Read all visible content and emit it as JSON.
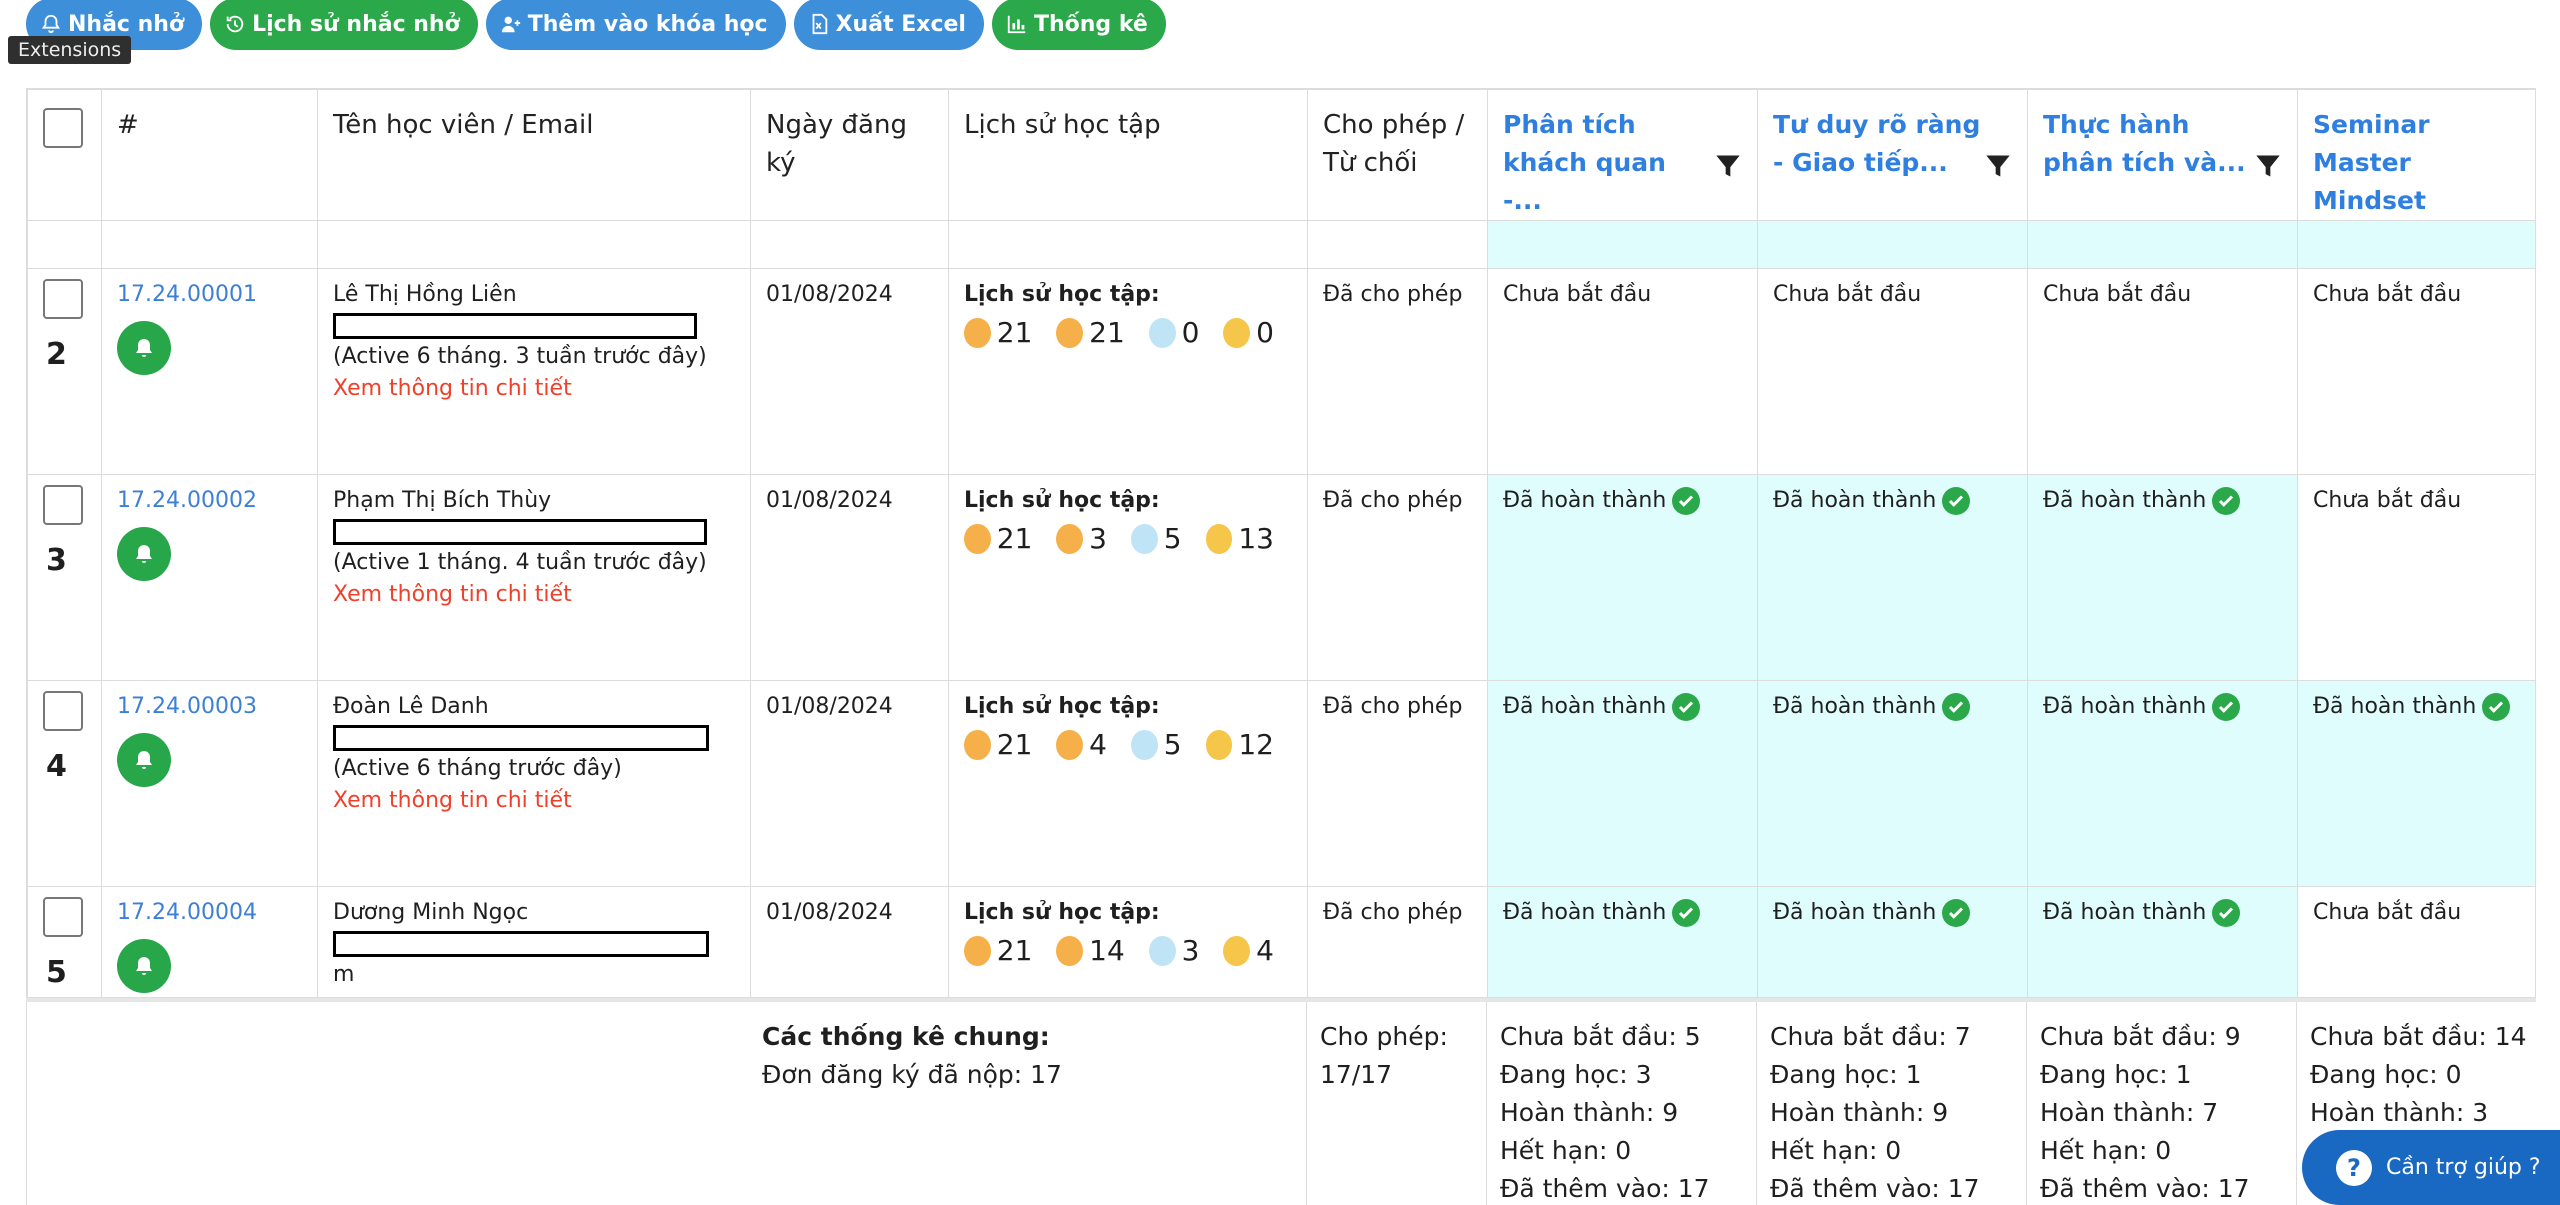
{
  "toolbar": {
    "buttons": [
      {
        "label": "Nhắc nhở",
        "icon": "bell-icon",
        "color": "#3d8fd9"
      },
      {
        "label": "Lịch sử nhắc nhở",
        "icon": "history-icon",
        "color": "#2aa84a"
      },
      {
        "label": "Thêm vào khóa học",
        "icon": "add-user-icon",
        "color": "#3d8fd9"
      },
      {
        "label": "Xuất Excel",
        "icon": "excel-file-icon",
        "color": "#3d8fd9"
      },
      {
        "label": "Thống kê",
        "icon": "bar-chart-icon",
        "color": "#2aa84a"
      }
    ],
    "tooltip": "Extensions"
  },
  "table": {
    "headers": {
      "num": "#",
      "name": "Tên học viên / Email",
      "date": "Ngày đăng ký",
      "history": "Lịch sử học tập",
      "permit": "Cho phép / Từ chối",
      "course1": "Phân tích khách quan -...",
      "course2": "Tư duy rõ ràng - Giao tiếp...",
      "course3": "Thực hành phân tích và...",
      "course4": "Seminar Master Mindset"
    },
    "rows": [
      {
        "num": "2",
        "code": "17.24.00001",
        "name": "Lê Thị Hồng Liên",
        "active": "(Active 6 tháng. 3 tuần trước đây)",
        "detail": "Xem thông tin chi tiết",
        "date": "01/08/2024",
        "history_label": "Lịch sử học tập:",
        "stats": [
          "21",
          "21",
          "0",
          "0"
        ],
        "permit": "Đã cho phép",
        "courses": [
          "Chưa bắt đầu",
          "Chưa bắt đầu",
          "Chưa bắt đầu",
          "Chưa bắt đầu"
        ]
      },
      {
        "num": "3",
        "code": "17.24.00002",
        "name": "Phạm Thị Bích Thùy",
        "active": "(Active 1 tháng. 4 tuần trước đây)",
        "detail": "Xem thông tin chi tiết",
        "date": "01/08/2024",
        "history_label": "Lịch sử học tập:",
        "stats": [
          "21",
          "3",
          "5",
          "13"
        ],
        "permit": "Đã cho phép",
        "courses": [
          "Đã hoàn thành",
          "Đã hoàn thành",
          "Đã hoàn thành",
          "Chưa bắt đầu"
        ]
      },
      {
        "num": "4",
        "code": "17.24.00003",
        "name": "Đoàn Lê Danh",
        "active": "(Active 6 tháng trước đây)",
        "detail": "Xem thông tin chi tiết",
        "date": "01/08/2024",
        "history_label": "Lịch sử học tập:",
        "stats": [
          "21",
          "4",
          "5",
          "12"
        ],
        "permit": "Đã cho phép",
        "courses": [
          "Đã hoàn thành",
          "Đã hoàn thành",
          "Đã hoàn thành",
          "Đã hoàn thành"
        ]
      },
      {
        "num": "5",
        "code": "17.24.00004",
        "name": "Dương Minh Ngọc",
        "email_tail": "m",
        "date": "01/08/2024",
        "history_label": "Lịch sử học tập:",
        "stats": [
          "21",
          "14",
          "3",
          "4"
        ],
        "permit": "Đã cho phép",
        "courses": [
          "Đã hoàn thành",
          "Đã hoàn thành",
          "Đã hoàn thành",
          "Chưa bắt đầu"
        ]
      }
    ]
  },
  "footer": {
    "general_title": "Các thống kê chung:",
    "submitted": "Đơn đăng ký đã nộp: 17",
    "permit": "Cho phép: 17/17",
    "course_stats": [
      [
        "Chưa bắt đầu: 5",
        "Đang học: 3",
        "Hoàn thành: 9",
        "Hết hạn: 0",
        "Đã thêm vào: 17"
      ],
      [
        "Chưa bắt đầu: 7",
        "Đang học: 1",
        "Hoàn thành: 9",
        "Hết hạn: 0",
        "Đã thêm vào: 17"
      ],
      [
        "Chưa bắt đầu: 9",
        "Đang học: 1",
        "Hoàn thành: 7",
        "Hết hạn: 0",
        "Đã thêm vào: 17"
      ],
      [
        "Chưa bắt đầu: 14",
        "Đang học: 0",
        "Hoàn thành: 3"
      ]
    ]
  },
  "help": {
    "label": "Cần trợ giúp ?"
  }
}
